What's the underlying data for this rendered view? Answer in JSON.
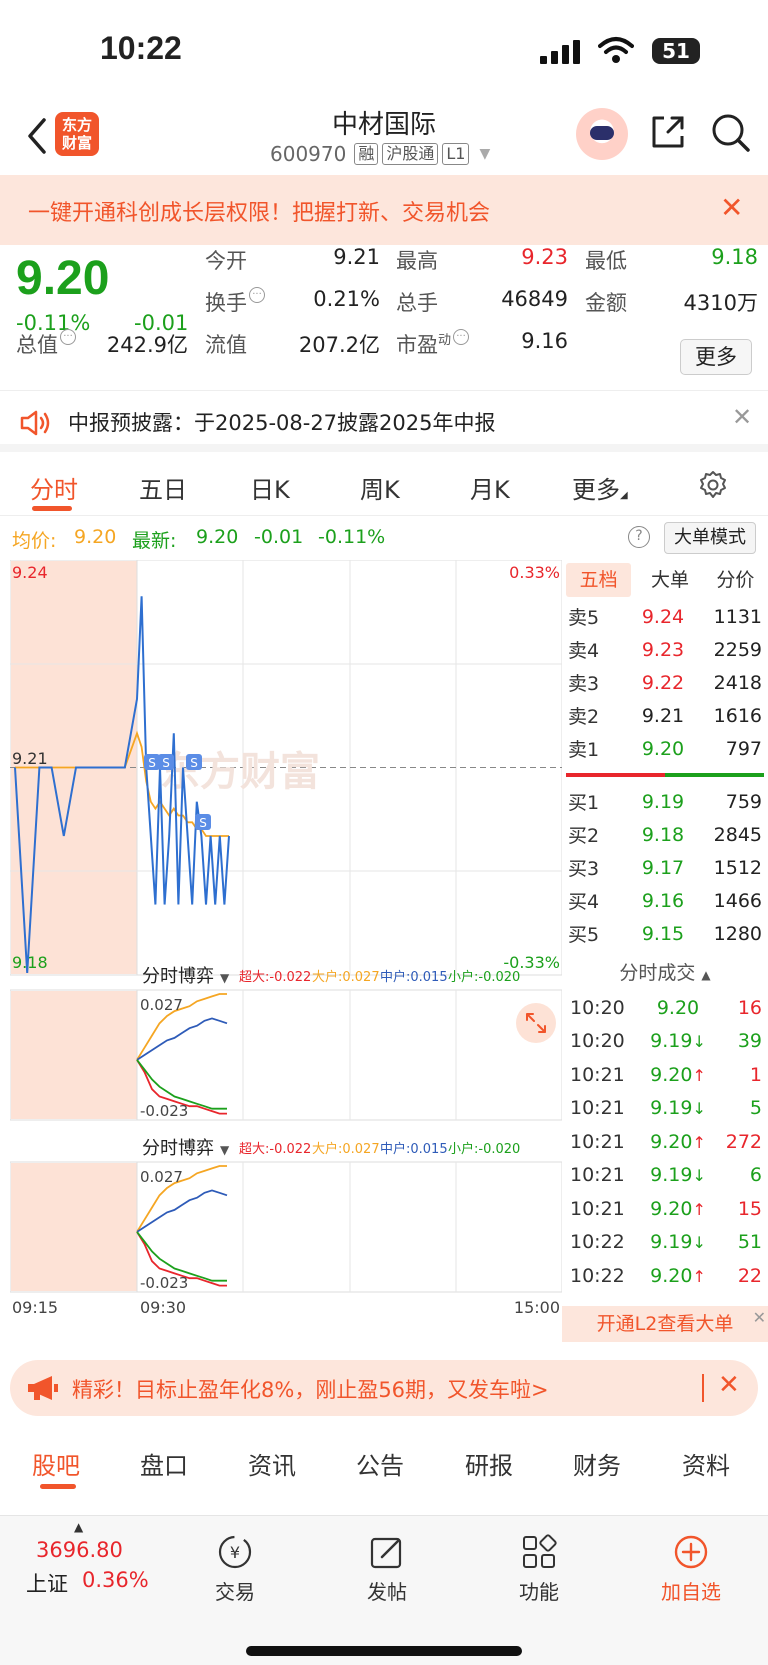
{
  "status": {
    "time": "10:22",
    "battery": "51"
  },
  "header": {
    "logo_line1": "东方",
    "logo_line2": "财富",
    "title": "中材国际",
    "code": "600970",
    "tags": [
      "融",
      "沪股通",
      "L1"
    ]
  },
  "promo": {
    "text": "一键开通科创成长层权限！把握打新、交易机会"
  },
  "quote": {
    "price": "9.20",
    "change_pct": "-0.11%",
    "change": "-0.01",
    "open_label": "今开",
    "open": "9.21",
    "high_label": "最高",
    "high": "9.23",
    "low_label": "最低",
    "low": "9.18",
    "turnover_label": "换手",
    "turnover": "0.21%",
    "volume_label": "总手",
    "volume": "46849",
    "amount_label": "金额",
    "amount": "4310万",
    "mktcap_label": "总值",
    "mktcap": "242.9亿",
    "float_label": "流值",
    "float": "207.2亿",
    "pe_label": "市盈",
    "pe_sup": "动",
    "pe": "9.16",
    "more": "更多"
  },
  "notice": {
    "text": "中报预披露：于2025-08-27披露2025年中报"
  },
  "chart_tabs": [
    "分时",
    "五日",
    "日K",
    "周K",
    "月K",
    "更多"
  ],
  "avg": {
    "avg_label": "均价:",
    "avg_value": "9.20",
    "latest_label": "最新:",
    "latest_value": "9.20",
    "latest_change": "-0.01",
    "latest_pct": "-0.11%",
    "mode_button": "大单模式"
  },
  "chart_data": [
    {
      "type": "line",
      "price_labels": {
        "top": "9.24",
        "mid": "9.21",
        "bottom": "9.18",
        "top_pct": "0.33%",
        "bottom_pct": "-0.33%"
      },
      "ylim": [
        9.18,
        9.24
      ],
      "prev_close": 9.21,
      "x_labels": [
        "09:15",
        "09:30",
        "15:00"
      ],
      "watermark": "东方财富",
      "series": [
        {
          "values": [
            9.21,
            9.18,
            9.21,
            9.21,
            9.2,
            9.21,
            9.21,
            9.21,
            9.21,
            9.21,
            9.22,
            9.235,
            9.21,
            9.2,
            9.19,
            9.21,
            9.19,
            9.2,
            9.215,
            9.19,
            9.21,
            9.2,
            9.19,
            9.205,
            9.2,
            9.19,
            9.2,
            9.19,
            9.2,
            9.19,
            9.2
          ]
        },
        {
          "values": [
            9.21,
            9.21,
            9.21,
            9.21,
            9.21,
            9.21,
            9.21,
            9.21,
            9.21,
            9.21,
            9.215,
            9.213,
            9.208,
            9.205,
            9.204,
            9.205,
            9.204,
            9.203,
            9.204,
            9.203,
            9.203,
            9.202,
            9.202,
            9.201,
            9.201,
            9.2,
            9.2,
            9.2,
            9.2,
            9.2,
            9.2
          ]
        }
      ],
      "signals": [
        "S",
        "S",
        "S",
        "S"
      ]
    },
    {
      "type": "line",
      "title": "分时博弈",
      "legend": [
        {
          "label": "超大:-0.022",
          "color": "#e8262c"
        },
        {
          "label": "大户:0.027",
          "color": "#f5a623"
        },
        {
          "label": "中户:0.015",
          "color": "#2e5bb8"
        },
        {
          "label": "小户:-0.020",
          "color": "#1ca01c"
        }
      ],
      "y_labels": {
        "top": "0.027",
        "bottom": "-0.023"
      },
      "ylim": [
        -0.023,
        0.027
      ],
      "series": [
        {
          "values": [
            0.0,
            -0.005,
            -0.012,
            -0.015,
            -0.016,
            -0.017,
            -0.018,
            -0.019,
            -0.019,
            -0.02,
            -0.021,
            -0.022,
            -0.022
          ]
        },
        {
          "values": [
            0.0,
            0.005,
            0.01,
            0.015,
            0.018,
            0.02,
            0.021,
            0.022,
            0.024,
            0.025,
            0.026,
            0.027,
            0.027
          ]
        },
        {
          "values": [
            0.0,
            0.002,
            0.004,
            0.006,
            0.008,
            0.009,
            0.011,
            0.013,
            0.014,
            0.016,
            0.017,
            0.016,
            0.015
          ]
        },
        {
          "values": [
            0.0,
            -0.004,
            -0.008,
            -0.011,
            -0.013,
            -0.015,
            -0.016,
            -0.017,
            -0.018,
            -0.019,
            -0.02,
            -0.02,
            -0.02
          ]
        }
      ]
    }
  ],
  "book": {
    "tabs": [
      "五档",
      "大单",
      "分价"
    ],
    "asks": [
      {
        "label": "卖5",
        "price": "9.24",
        "vol": "1131",
        "c": "red"
      },
      {
        "label": "卖4",
        "price": "9.23",
        "vol": "2259",
        "c": "red"
      },
      {
        "label": "卖3",
        "price": "9.22",
        "vol": "2418",
        "c": "red"
      },
      {
        "label": "卖2",
        "price": "9.21",
        "vol": "1616",
        "c": "black"
      },
      {
        "label": "卖1",
        "price": "9.20",
        "vol": "797",
        "c": "green"
      }
    ],
    "bids": [
      {
        "label": "买1",
        "price": "9.19",
        "vol": "759",
        "c": "green"
      },
      {
        "label": "买2",
        "price": "9.18",
        "vol": "2845",
        "c": "green"
      },
      {
        "label": "买3",
        "price": "9.17",
        "vol": "1512",
        "c": "green"
      },
      {
        "label": "买4",
        "price": "9.16",
        "vol": "1466",
        "c": "green"
      },
      {
        "label": "买5",
        "price": "9.15",
        "vol": "1280",
        "c": "green"
      }
    ]
  },
  "ticks": {
    "title": "分时成交",
    "rows": [
      {
        "time": "10:20",
        "price": "9.20",
        "arrow": "",
        "vol": "16",
        "pc": "green",
        "vc": "red"
      },
      {
        "time": "10:20",
        "price": "9.19",
        "arrow": "↓",
        "vol": "39",
        "pc": "green",
        "vc": "green"
      },
      {
        "time": "10:21",
        "price": "9.20",
        "arrow": "↑",
        "vol": "1",
        "pc": "green",
        "vc": "red"
      },
      {
        "time": "10:21",
        "price": "9.19",
        "arrow": "↓",
        "vol": "5",
        "pc": "green",
        "vc": "green"
      },
      {
        "time": "10:21",
        "price": "9.20",
        "arrow": "↑",
        "vol": "272",
        "pc": "green",
        "vc": "red"
      },
      {
        "time": "10:21",
        "price": "9.19",
        "arrow": "↓",
        "vol": "6",
        "pc": "green",
        "vc": "green"
      },
      {
        "time": "10:21",
        "price": "9.20",
        "arrow": "↑",
        "vol": "15",
        "pc": "green",
        "vc": "red"
      },
      {
        "time": "10:22",
        "price": "9.19",
        "arrow": "↓",
        "vol": "51",
        "pc": "green",
        "vc": "green"
      },
      {
        "time": "10:22",
        "price": "9.20",
        "arrow": "↑",
        "vol": "22",
        "pc": "green",
        "vc": "red"
      }
    ],
    "l2_button": "开通L2查看大单"
  },
  "ad": {
    "text": "精彩！目标止盈年化8%，刚止盈56期，又发车啦>"
  },
  "bottom_tabs": [
    "股吧",
    "盘口",
    "资讯",
    "公告",
    "研报",
    "财务",
    "资料"
  ],
  "dock": {
    "index_value": "3696.80",
    "index_name": "上证",
    "index_change": "0.36%",
    "items": [
      "交易",
      "发帖",
      "功能",
      "加自选"
    ]
  },
  "colors": {
    "accent": "#f1552b",
    "up": "#e8262c",
    "down": "#1ca01c",
    "line": "#2e6fd0",
    "avg": "#f5a623"
  }
}
